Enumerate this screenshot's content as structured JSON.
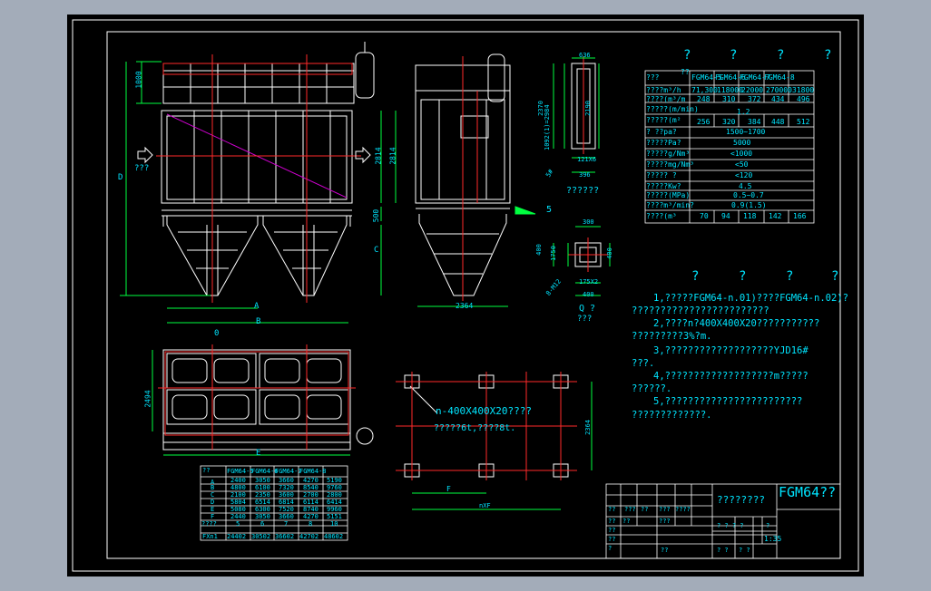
{
  "colors": {
    "background": "#a3acb9",
    "sheet": "#000000",
    "outline": "#ffffff",
    "text": "#00e5ff",
    "center": "#ff2a2a",
    "dimension": "#00ff40",
    "diagonal": "#d000d0"
  },
  "spec_table": {
    "title_marks": [
      "?",
      "?",
      "?",
      "?"
    ],
    "header": [
      "???",
      "??",
      "FGM64-5",
      "FGM64-6",
      "FGM64-7",
      "FGM64-8"
    ],
    "rows": [
      [
        "????m³/h",
        "71,300",
        "118000",
        "22000",
        "270000",
        "31800"
      ],
      [
        "????(m³/m",
        "248",
        "310",
        "372",
        "434",
        "496"
      ],
      [
        "?????(m/min)",
        "1.2"
      ],
      [
        "?????(m²",
        "256",
        "320",
        "384",
        "448",
        "512"
      ],
      [
        "?  ??pa?",
        "1500~1700"
      ],
      [
        "?????Pa?",
        "5000"
      ],
      [
        "?????g/Nm³",
        "<1000"
      ],
      [
        "?????mg/Nm³",
        "<50"
      ],
      [
        "?????   ?",
        "<120"
      ],
      [
        "?????Kw?",
        "4.5"
      ],
      [
        "?????(MPa)",
        "0.5~0.7"
      ],
      [
        "????m³/min?",
        "0.9(1.5)"
      ],
      [
        "????(m³",
        "70",
        "94",
        "118",
        "142",
        "166"
      ]
    ]
  },
  "notes": {
    "title_marks": [
      "?",
      "?",
      "?",
      "?"
    ],
    "lines": [
      "1,?????FGM64-n.01)????FGM64-n.02)?",
      "????????????????????????",
      "2,????n?400X400X20???????????",
      "?????????3%?m.",
      "3,???????????????????YJD16#",
      "???.",
      "4,???????????????????m?????",
      "??????.",
      "5,????????????????????????",
      "?????????????."
    ]
  },
  "dim_table": {
    "header": [
      "??",
      "FGM64-5",
      "FGM64-6",
      "FGM64-7",
      "FGM64-8"
    ],
    "rows": [
      [
        "A",
        "2400",
        "3050",
        "3660",
        "4270",
        "5190"
      ],
      [
        "B",
        "4800",
        "6100",
        "7320",
        "8540",
        "9760"
      ],
      [
        "C",
        "2100",
        "2350",
        "3600",
        "2700",
        "2800"
      ],
      [
        "D",
        "5804",
        "6514",
        "6814",
        "6114",
        "6414"
      ],
      [
        "E",
        "5080",
        "6300",
        "7520",
        "8740",
        "9960"
      ],
      [
        "F",
        "2440",
        "3050",
        "3660",
        "4270",
        "5151"
      ],
      [
        "????",
        "5",
        "6",
        "7",
        "8",
        "10"
      ],
      [
        "FXn1",
        "24402",
        "30502",
        "36602",
        "42702",
        "48602"
      ]
    ]
  },
  "drawing": {
    "side_dims": [
      "1000",
      "D",
      "2814",
      "2814",
      "500",
      "C"
    ],
    "front_dims": [
      "A",
      "B",
      "0"
    ],
    "side2_dim": "2364",
    "plan_dims": [
      "2494",
      "E"
    ],
    "detail_top": [
      "636",
      "2370",
      "1092(1)=2984",
      "2190",
      "5#",
      "121X6",
      "396",
      "??????"
    ],
    "detail_bottom": [
      "300",
      "400",
      "1750",
      "400",
      "8-M12",
      "175X2",
      "400",
      "Q ?",
      "???"
    ],
    "inlet_label": "???",
    "weld_mark": "5",
    "foundation": {
      "callout": "n-400X400X20????",
      "note": "?????6t,????8t.",
      "dim_right": "2364",
      "dim_f": "F",
      "dim_total": "nXF"
    }
  },
  "title_block": {
    "drawing_name": "????????",
    "product": "FGM64??",
    "scale": "1:35",
    "grid": [
      "??",
      "???",
      "??",
      "???",
      "????",
      "??",
      "??",
      "??",
      "???",
      "?",
      "??",
      "? ?",
      "? ?",
      "??",
      "? ? ? ?",
      "?"
    ]
  }
}
